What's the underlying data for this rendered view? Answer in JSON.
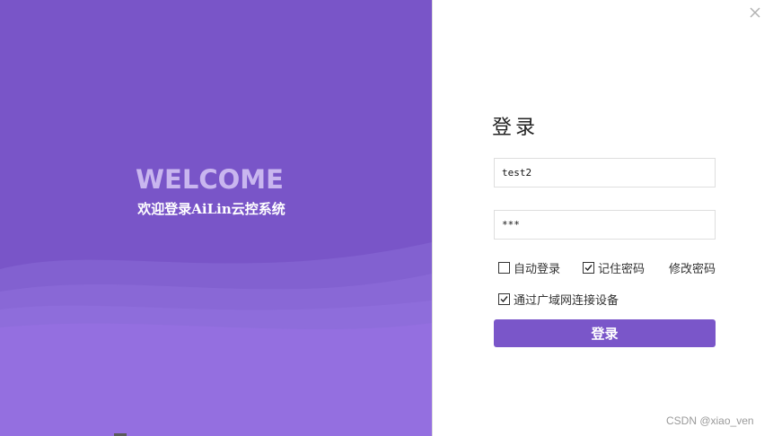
{
  "window": {
    "close_symbol": "×"
  },
  "welcome": {
    "title": "WELCOME",
    "subtitle": "欢迎登录AiLin云控系统"
  },
  "login": {
    "title": "登录",
    "username_value": "test2",
    "password_value": "***",
    "auto_login_label": "自动登录",
    "auto_login_checked": false,
    "remember_password_label": "记住密码",
    "remember_password_checked": true,
    "change_password_link": "修改密码",
    "wan_connect_label": "通过广域网连接设备",
    "wan_connect_checked": true,
    "submit_label": "登录"
  },
  "watermark": {
    "text": "CSDN @xiao_ven"
  },
  "colors": {
    "brand_purple": "#7955c8",
    "button_purple": "#7a56c9",
    "welcome_text": "#c9b6ef"
  },
  "icons": {
    "close": "close-icon",
    "checkbox_tick": "checkmark-icon"
  }
}
